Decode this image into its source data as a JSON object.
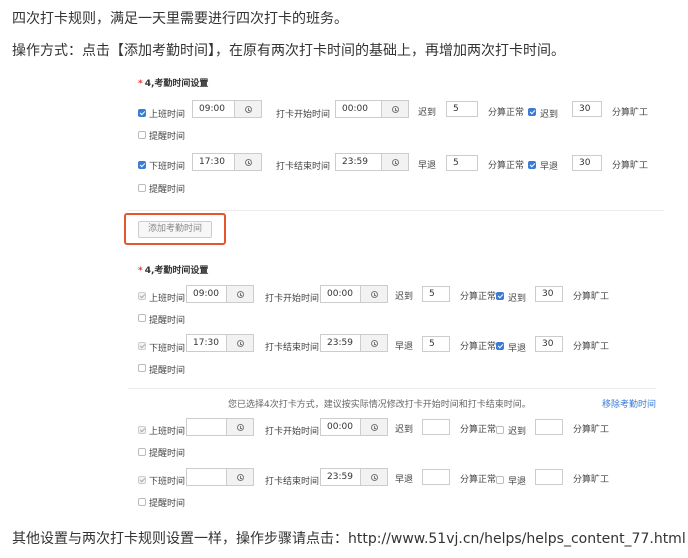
{
  "intro": {
    "line1": "四次打卡规则，满足一天里需要进行四次打卡的班务。",
    "line2": "操作方式：点击【添加考勤时间】，在原有两次打卡时间的基础上，再增加两次打卡时间。",
    "footer": "其他设置与两次打卡规则设置一样，操作步骤请点击：http://www.51vj.cn/helps/helps_content_77.html"
  },
  "labels": {
    "star": "*",
    "section_title": "4,考勤时间设置",
    "work_start": "上班时间",
    "work_end": "下班时间",
    "reminder": "提醒时间",
    "punch_start": "打卡开始时间",
    "punch_end": "打卡结束时间",
    "late": "迟到",
    "early": "早退",
    "normal": "分算正常",
    "absent": "分算旷工",
    "add_button": "添加考勤时间",
    "notice": "您已选择4次打卡方式，建议按实际情况修改打卡开始时间和打卡结束时间。",
    "remove_link": "移除考勤时间"
  },
  "sections": [
    {
      "rows": [
        {
          "time": "09:00",
          "punch": "00:00",
          "minutes": "5",
          "absent_min": "30"
        },
        {
          "time": "17:30",
          "punch": "23:59",
          "minutes": "5",
          "absent_min": "30"
        }
      ]
    },
    {
      "rows": [
        {
          "time": "09:00",
          "punch": "00:00",
          "minutes": "5",
          "absent_min": "30"
        },
        {
          "time": "17:30",
          "punch": "23:59",
          "minutes": "5",
          "absent_min": "30"
        },
        {
          "time": "",
          "punch": "00:00",
          "minutes": "",
          "absent_min": ""
        },
        {
          "time": "",
          "punch": "23:59",
          "minutes": "",
          "absent_min": ""
        }
      ]
    }
  ],
  "colors": {
    "accent": "#3a7bd5",
    "highlight": "#e4572e",
    "required": "#e4393c"
  }
}
